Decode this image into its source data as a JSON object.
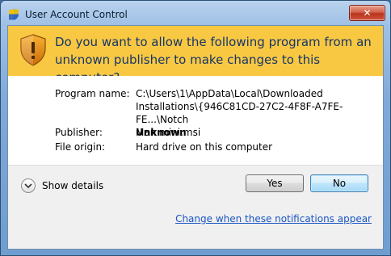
{
  "window": {
    "title": "User Account Control",
    "close_glyph": "✕"
  },
  "banner": {
    "question": "Do you want to allow the following program from an unknown publisher to make changes to this computer?",
    "icon": "uac-warning-shield-icon"
  },
  "details": {
    "program_label": "Program name:",
    "program_value_lines": [
      "C:\\Users\\1\\AppData\\Local\\Downloaded",
      "Installations\\{946C81CD-27C2-4F8F-A7FE-FE...\\Notch",
      "Man mini.msi"
    ],
    "publisher_label": "Publisher:",
    "publisher_value": "Unknown",
    "origin_label": "File origin:",
    "origin_value": "Hard drive on this computer"
  },
  "buttons": {
    "show_details": "Show details",
    "yes": "Yes",
    "no": "No"
  },
  "footer": {
    "link": "Change when these notifications appear"
  },
  "colors": {
    "banner": "#f9c842",
    "question_text": "#15356b",
    "link": "#1a56c4"
  }
}
